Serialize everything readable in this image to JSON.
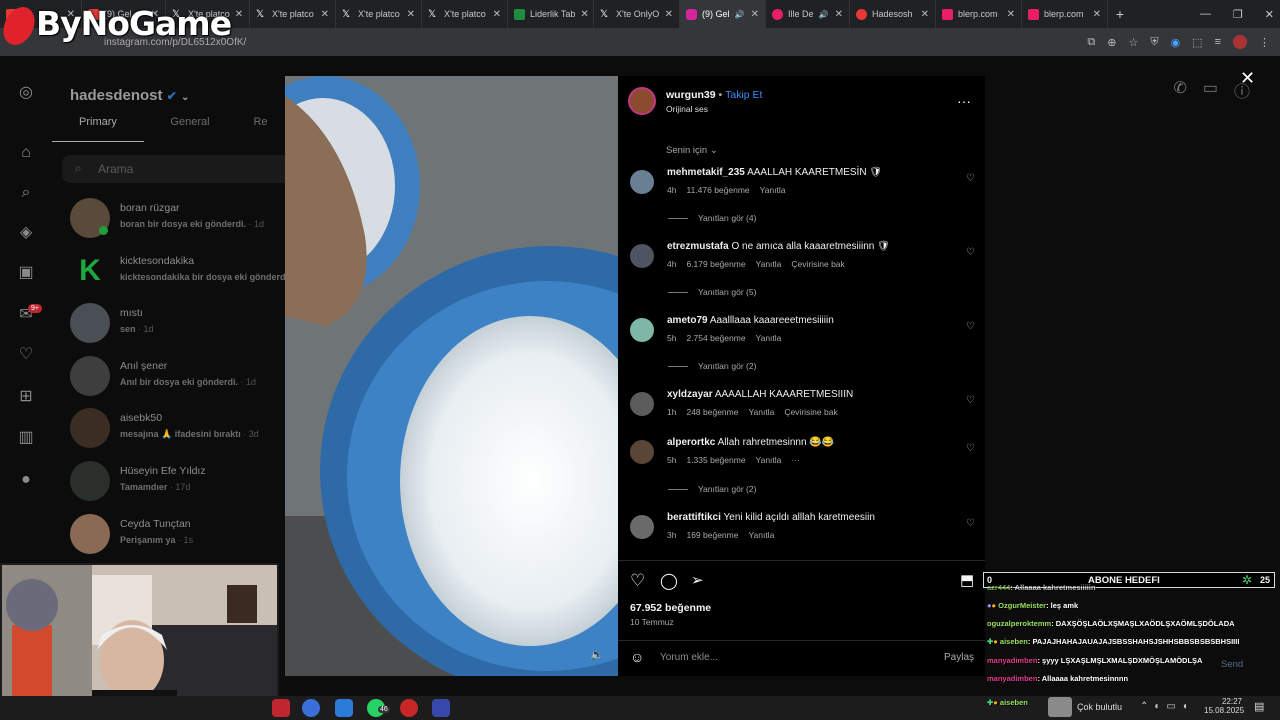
{
  "browser": {
    "tabs": [
      {
        "label": "...",
        "color": "#e53935",
        "active": false
      },
      {
        "label": "(9) Gel",
        "color": "#e53935",
        "active": false
      },
      {
        "label": "X'te platco",
        "color": "#ffffff",
        "active": false
      },
      {
        "label": "X'te platco",
        "color": "#ffffff",
        "active": false
      },
      {
        "label": "X'te platco",
        "color": "#ffffff",
        "active": false
      },
      {
        "label": "X'te platco",
        "color": "#ffffff",
        "active": false
      },
      {
        "label": "Liderlik Tab",
        "color": "#1e8e3e",
        "active": false
      },
      {
        "label": "X'te OnlyO",
        "color": "#ffffff",
        "active": false
      },
      {
        "label": "(9) Gel",
        "color": "#d6249f",
        "active": true
      },
      {
        "label": "Ille De",
        "color": "#e91e63",
        "active": false
      },
      {
        "label": "Hadesosh",
        "color": "#e53935",
        "active": false
      },
      {
        "label": "blerp.com",
        "color": "#e91e63",
        "active": false
      },
      {
        "label": "blerp.com",
        "color": "#e91e63",
        "active": false
      }
    ],
    "url": "instagram.com/p/DL6512x0OfK/"
  },
  "logo_text": "ByNoGame",
  "dm": {
    "username": "hadesdenost",
    "tabs": [
      "Primary",
      "General",
      "Re"
    ],
    "search_placeholder": "Arama",
    "badge": "9+",
    "conversations": [
      {
        "name": "boran rüzgar",
        "message": "boran bir dosya eki gönderdi.",
        "time": "· 1d"
      },
      {
        "name": "kicktesondakika",
        "message": "kicktesondakika bir dosya eki gönderdi.",
        "time": ""
      },
      {
        "name": "mıstı",
        "message": "sen",
        "time": "· 1d"
      },
      {
        "name": "Anıl şener",
        "message": "Anıl bir dosya eki gönderdi.",
        "time": "· 1d"
      },
      {
        "name": "aisebk50",
        "message": "mesajına 🙏 ifadesini bıraktı",
        "time": "· 3d"
      },
      {
        "name": "Hüseyin Efe Yıldız",
        "message": "Tamamdıer",
        "time": "· 17d"
      },
      {
        "name": "Ceyda Tunçtan",
        "message": "Perişanım ya",
        "time": "· 1s"
      }
    ]
  },
  "post": {
    "author": "wurgun39",
    "follow_label": "Takip Et",
    "audio": "Orijinal ses",
    "sort_label": "Senin için",
    "comments": [
      {
        "user": "mehmetakif_235",
        "text": "AAALLAH KAARETMESİN 🛡",
        "time": "4h",
        "likes": "11.476 beğenme",
        "reply": "Yanıtla",
        "translate": "",
        "replies": "Yanıtları gör (4)"
      },
      {
        "user": "etrezmustafa",
        "text": "O ne amıca alla kaaaretmesiiinn 🛡",
        "time": "4h",
        "likes": "6.179 beğenme",
        "reply": "Yanıtla",
        "translate": "Çevirisine bak",
        "replies": "Yanıtları gör (5)"
      },
      {
        "user": "ameto79",
        "text": "Aaalllaaa kaaareeetmesiiiiin",
        "time": "5h",
        "likes": "2.754 beğenme",
        "reply": "Yanıtla",
        "translate": "",
        "replies": "Yanıtları gör (2)"
      },
      {
        "user": "xyldzayar",
        "text": "AAAALLAH KAAARETMESIIIN",
        "time": "1h",
        "likes": "248 beğenme",
        "reply": "Yanıtla",
        "translate": "Çevirisine bak",
        "replies": ""
      },
      {
        "user": "alperortkc",
        "text": "Allah rahretmesinnn 😂😂",
        "time": "5h",
        "likes": "1.335 beğenme",
        "reply": "Yanıtla",
        "translate": "···",
        "replies": "Yanıtları gör (2)"
      },
      {
        "user": "berattiftikci",
        "text": "Yeni kilid açıldı alllah karetmeesiin",
        "time": "3h",
        "likes": "169 beğenme",
        "reply": "Yanıtla",
        "translate": "",
        "replies": ""
      }
    ],
    "likes": "67.952 beğenme",
    "date": "10 Temmuz",
    "comment_placeholder": "Yorum ekle...",
    "share_label": "Paylaş"
  },
  "stream": {
    "goal_left": "0",
    "goal_label": "ABONE HEDEFI",
    "goal_right": "25",
    "chat": [
      {
        "user": "azr444",
        "text": ": Allaaaa kahretmesiiiiin",
        "color": "#9be15d"
      },
      {
        "user": "OzgurMeister",
        "text": ": leş amk",
        "color": "#9be15d"
      },
      {
        "user": "oguzalperoktemm",
        "text": ": DAXŞÖŞLAÖLXŞMAŞLXAÖDLŞXAÖMLŞDÖLADA",
        "color": "#9be15d"
      },
      {
        "user": "aiseben",
        "text": ": PAJAJHAHAJAUAJAJSBSSHAHSJSHHSBBSBSBSBHSIIII",
        "color": "#9be15d"
      },
      {
        "user": "manyadimben",
        "text": ": şyyy LŞXAŞLMŞLXMALŞDXMÖŞLAMÖDLŞA",
        "color": "#e33f8f"
      },
      {
        "user": "manyadimben",
        "text": ": Allaaaa kahretmesinnnn",
        "color": "#e33f8f"
      }
    ],
    "chat_send": "Send",
    "last_user": "aiseben"
  },
  "taskbar": {
    "weather": "Çok bulutlu",
    "time": "22:27",
    "date": "15.08.2025",
    "whatsapp_badge": "46"
  }
}
